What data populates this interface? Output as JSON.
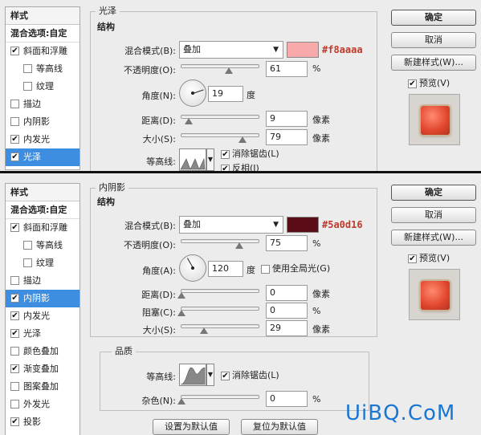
{
  "common": {
    "styles_title": "样式",
    "blend_options": "混合选项:自定",
    "ok": "确定",
    "cancel": "取消",
    "new_style": "新建样式(W)...",
    "preview": "预览(V)",
    "structure": "结构",
    "blend_mode_label": "混合模式(B):",
    "opacity_label": "不透明度(O):",
    "percent": "%",
    "pixels": "像素",
    "degree": "度",
    "antialias": "消除锯齿(L)",
    "contour_label": "等高线:"
  },
  "panel_a": {
    "section_title": "光泽",
    "styles": [
      {
        "label": "斜面和浮雕",
        "checked": true,
        "indent": false,
        "selected": false
      },
      {
        "label": "等高线",
        "checked": false,
        "indent": true,
        "selected": false
      },
      {
        "label": "纹理",
        "checked": false,
        "indent": true,
        "selected": false
      },
      {
        "label": "描边",
        "checked": false,
        "indent": false,
        "selected": false
      },
      {
        "label": "内阴影",
        "checked": false,
        "indent": false,
        "selected": false
      },
      {
        "label": "内发光",
        "checked": true,
        "indent": false,
        "selected": false
      },
      {
        "label": "光泽",
        "checked": true,
        "indent": false,
        "selected": true
      }
    ],
    "blend_mode": "叠加",
    "color_hex": "#f8aaaa",
    "opacity": "61",
    "angle_label": "角度(N):",
    "angle": "19",
    "distance_label": "距离(D):",
    "distance": "9",
    "size_label": "大小(S):",
    "size": "79",
    "invert": "反相(I)"
  },
  "panel_b": {
    "section_title": "内阴影",
    "styles": [
      {
        "label": "斜面和浮雕",
        "checked": true,
        "indent": false,
        "selected": false
      },
      {
        "label": "等高线",
        "checked": false,
        "indent": true,
        "selected": false
      },
      {
        "label": "纹理",
        "checked": false,
        "indent": true,
        "selected": false
      },
      {
        "label": "描边",
        "checked": false,
        "indent": false,
        "selected": false
      },
      {
        "label": "内阴影",
        "checked": true,
        "indent": false,
        "selected": true
      },
      {
        "label": "内发光",
        "checked": true,
        "indent": false,
        "selected": false
      },
      {
        "label": "光泽",
        "checked": true,
        "indent": false,
        "selected": false
      },
      {
        "label": "颜色叠加",
        "checked": false,
        "indent": false,
        "selected": false
      },
      {
        "label": "渐变叠加",
        "checked": true,
        "indent": false,
        "selected": false
      },
      {
        "label": "图案叠加",
        "checked": false,
        "indent": false,
        "selected": false
      },
      {
        "label": "外发光",
        "checked": false,
        "indent": false,
        "selected": false
      },
      {
        "label": "投影",
        "checked": true,
        "indent": false,
        "selected": false
      }
    ],
    "blend_mode": "叠加",
    "color_hex": "#5a0d16",
    "opacity": "75",
    "angle_label": "角度(A):",
    "angle": "120",
    "global_light": "使用全局光(G)",
    "distance_label": "距离(D):",
    "distance": "0",
    "choke_label": "阻塞(C):",
    "choke": "0",
    "size_label": "大小(S):",
    "size": "29",
    "quality": "品质",
    "noise_label": "杂色(N):",
    "noise": "0",
    "make_default": "设置为默认值",
    "reset_default": "复位为默认值"
  },
  "watermark": "UiBQ.CoM",
  "colors": {
    "selection": "#3d8ee0",
    "swatch_a": "#f8aaaa",
    "swatch_b": "#5a0d16",
    "hex_text": "#c0392b",
    "watermark": "#1976d2"
  },
  "sliders": {
    "a_opacity": 61,
    "a_distance": 9,
    "a_size": 79,
    "b_opacity": 75,
    "b_distance": 0,
    "b_choke": 0,
    "b_size": 29,
    "b_noise": 0
  }
}
